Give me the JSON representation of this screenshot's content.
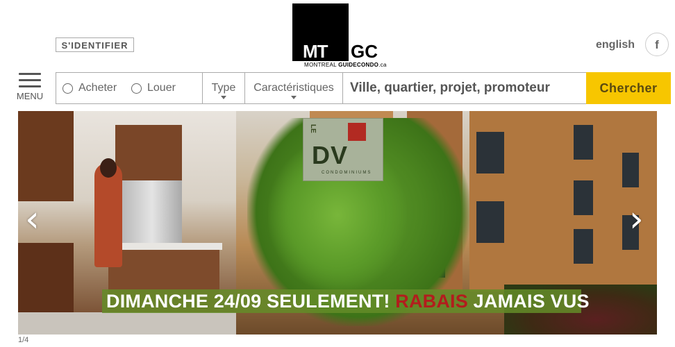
{
  "header": {
    "login_label": "S'IDENTIFIER",
    "logo": {
      "mark_left": "MT",
      "mark_right": "GC",
      "tagline_city": "MONTREAL",
      "tagline_site": "GUIDECONDO",
      "tagline_tld": ".ca"
    },
    "language_label": "english",
    "facebook_glyph": "f",
    "menu_label": "MENU"
  },
  "search": {
    "option_buy": "Acheter",
    "option_rent": "Louer",
    "type_label": "Type",
    "features_label": "Caractéristiques",
    "query_placeholder": "Ville, quartier, projet, promoteur",
    "submit_label": "Chercher",
    "accent_color": "#f7c600"
  },
  "slider": {
    "brand_logo": {
      "vertical": "LE",
      "letters": "DV",
      "caption": "CONDOMINIUMS"
    },
    "banner_part1": "DIMANCHE 24/09 SEULEMENT! ",
    "banner_highlight": "RABAIS",
    "banner_part2": " JAMAIS VUS",
    "prev_glyph": "‹",
    "next_glyph": "›",
    "counter": "1/4"
  }
}
